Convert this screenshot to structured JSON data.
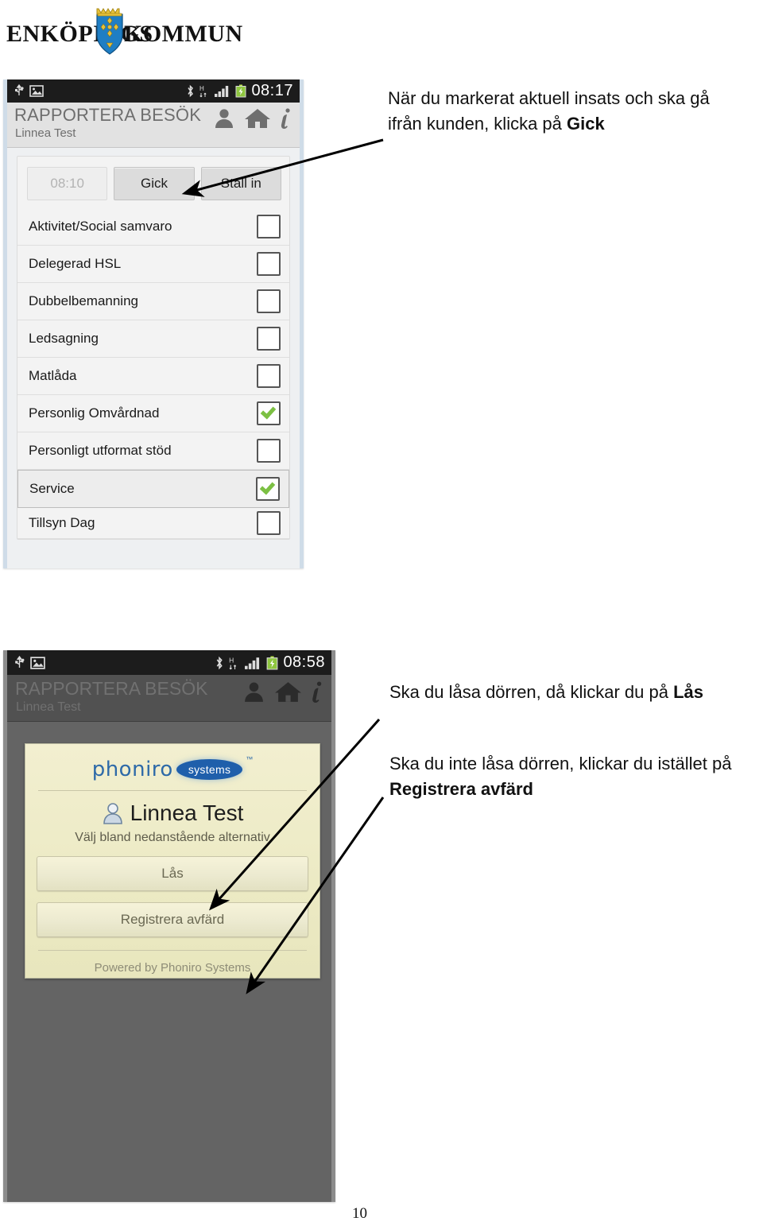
{
  "logo": {
    "text_left": "ENKÖPINGS",
    "text_right": "KOMMUN",
    "crest_name": "enkopings-kommun-coat-of-arms"
  },
  "screenshot_one": {
    "statusbar": {
      "icons": [
        "usb-icon",
        "image-icon",
        "bluetooth-icon",
        "hsdpa-icon",
        "signal-bars-icon",
        "battery-charging-icon"
      ],
      "time": "08:17"
    },
    "header": {
      "title": "RAPPORTERA BESÖK",
      "subtitle": "Linnea Test",
      "icons": [
        "person-icon",
        "home-icon",
        "info-icon"
      ]
    },
    "buttons": [
      {
        "label": "08:10",
        "state": "disabled"
      },
      {
        "label": "Gick",
        "state": "enabled"
      },
      {
        "label": "Ställ in",
        "state": "enabled"
      }
    ],
    "checklist": [
      {
        "label": "Aktivitet/Social samvaro",
        "checked": false,
        "selected": false
      },
      {
        "label": "Delegerad HSL",
        "checked": false,
        "selected": false
      },
      {
        "label": "Dubbelbemanning",
        "checked": false,
        "selected": false
      },
      {
        "label": "Ledsagning",
        "checked": false,
        "selected": false
      },
      {
        "label": "Matlåda",
        "checked": false,
        "selected": false
      },
      {
        "label": "Personlig Omvårdnad",
        "checked": true,
        "selected": false
      },
      {
        "label": "Personligt utformat stöd",
        "checked": false,
        "selected": false
      },
      {
        "label": "Service",
        "checked": true,
        "selected": true
      }
    ],
    "checklist_cut_off": {
      "label": "Tillsyn Dag",
      "checked": false
    }
  },
  "screenshot_two": {
    "statusbar": {
      "icons": [
        "usb-icon",
        "image-icon",
        "bluetooth-icon",
        "hsdpa-icon",
        "signal-bars-icon",
        "battery-charging-icon"
      ],
      "time": "08:58"
    },
    "header": {
      "title": "RAPPORTERA BESÖK",
      "subtitle": "Linnea Test",
      "icons": [
        "person-icon",
        "home-icon",
        "info-icon"
      ]
    },
    "dialog": {
      "brand_word": "phoniro",
      "brand_badge": "systems",
      "brand_tm": "™",
      "client_name": "Linnea Test",
      "instruction": "Välj bland nedanstående alternativ",
      "buttons": [
        {
          "label": "Lås"
        },
        {
          "label": "Registrera avfärd"
        }
      ],
      "footer": "Powered by Phoniro Systems"
    }
  },
  "annotations": {
    "one": {
      "line1": "När du markerat aktuell insats och ska gå",
      "line2_prefix": "ifrån kunden, klicka på ",
      "line2_bold": "Gick"
    },
    "two": {
      "prefix": "Ska du låsa dörren, då klickar du på ",
      "bold": "Lås"
    },
    "three": {
      "line1": "Ska du inte låsa dörren, klickar du istället på",
      "line2_bold": "Registrera avfärd"
    }
  },
  "footer": {
    "page_number": "10"
  },
  "colors": {
    "statusbar_bg": "#1c1c1c",
    "header_bg": "#e2e2e2",
    "check_green": "#7cc043",
    "brand_blue": "#1f5fab",
    "cream": "#eceac4"
  }
}
